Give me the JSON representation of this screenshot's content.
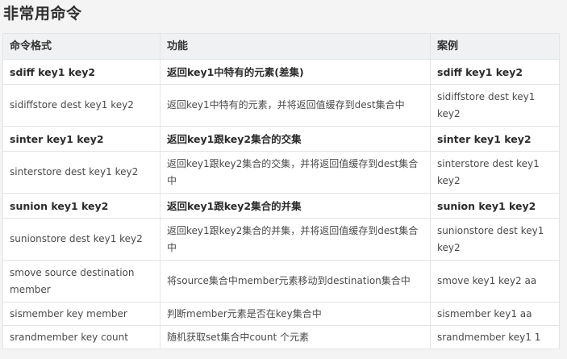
{
  "title": "非常用命令",
  "table": {
    "headers": [
      "命令格式",
      "功能",
      "案例"
    ],
    "rows": [
      {
        "cmd": "sdiff key1  key2",
        "desc": "返回key1中特有的元素(差集)",
        "example": "sdiff key1 key2",
        "bold": true
      },
      {
        "cmd": "sidiffstore  dest  key1 key2",
        "desc": "返回key1中特有的元素，并将返回值缓存到dest集合中",
        "example": "sidiffstore  dest  key1 key2",
        "bold": false
      },
      {
        "cmd": "sinter key1 key2",
        "desc": "返回key1跟key2集合的交集",
        "example": "sinter key1 key2",
        "bold": true
      },
      {
        "cmd": "sinterstore  dest key1 key2",
        "desc": "返回key1跟key2集合的交集，并将返回值缓存到dest集合中",
        "example": "sinterstore  dest key1 key2",
        "bold": false
      },
      {
        "cmd": "sunion key1  key2",
        "desc": "返回key1跟key2集合的并集",
        "example": "sunion key1  key2",
        "bold": true
      },
      {
        "cmd": "sunionstore dest key1  key2",
        "desc": "返回key1跟key2集合的并集，并将返回值缓存到dest集合中",
        "example": "sunionstore dest key1 key2",
        "bold": false
      },
      {
        "cmd": "smove source destination member",
        "desc": "将source集合中member元素移动到destination集合中",
        "example": "smove key1  key2 aa",
        "bold": false
      },
      {
        "cmd": "sismember key member",
        "desc": "判断member元素是否在key集合中",
        "example": "sismember key1   aa",
        "bold": false
      },
      {
        "cmd": "srandmember  key  count",
        "desc": "随机获取set集合中count 个元素",
        "example": "srandmember key1 1",
        "bold": false
      }
    ]
  }
}
